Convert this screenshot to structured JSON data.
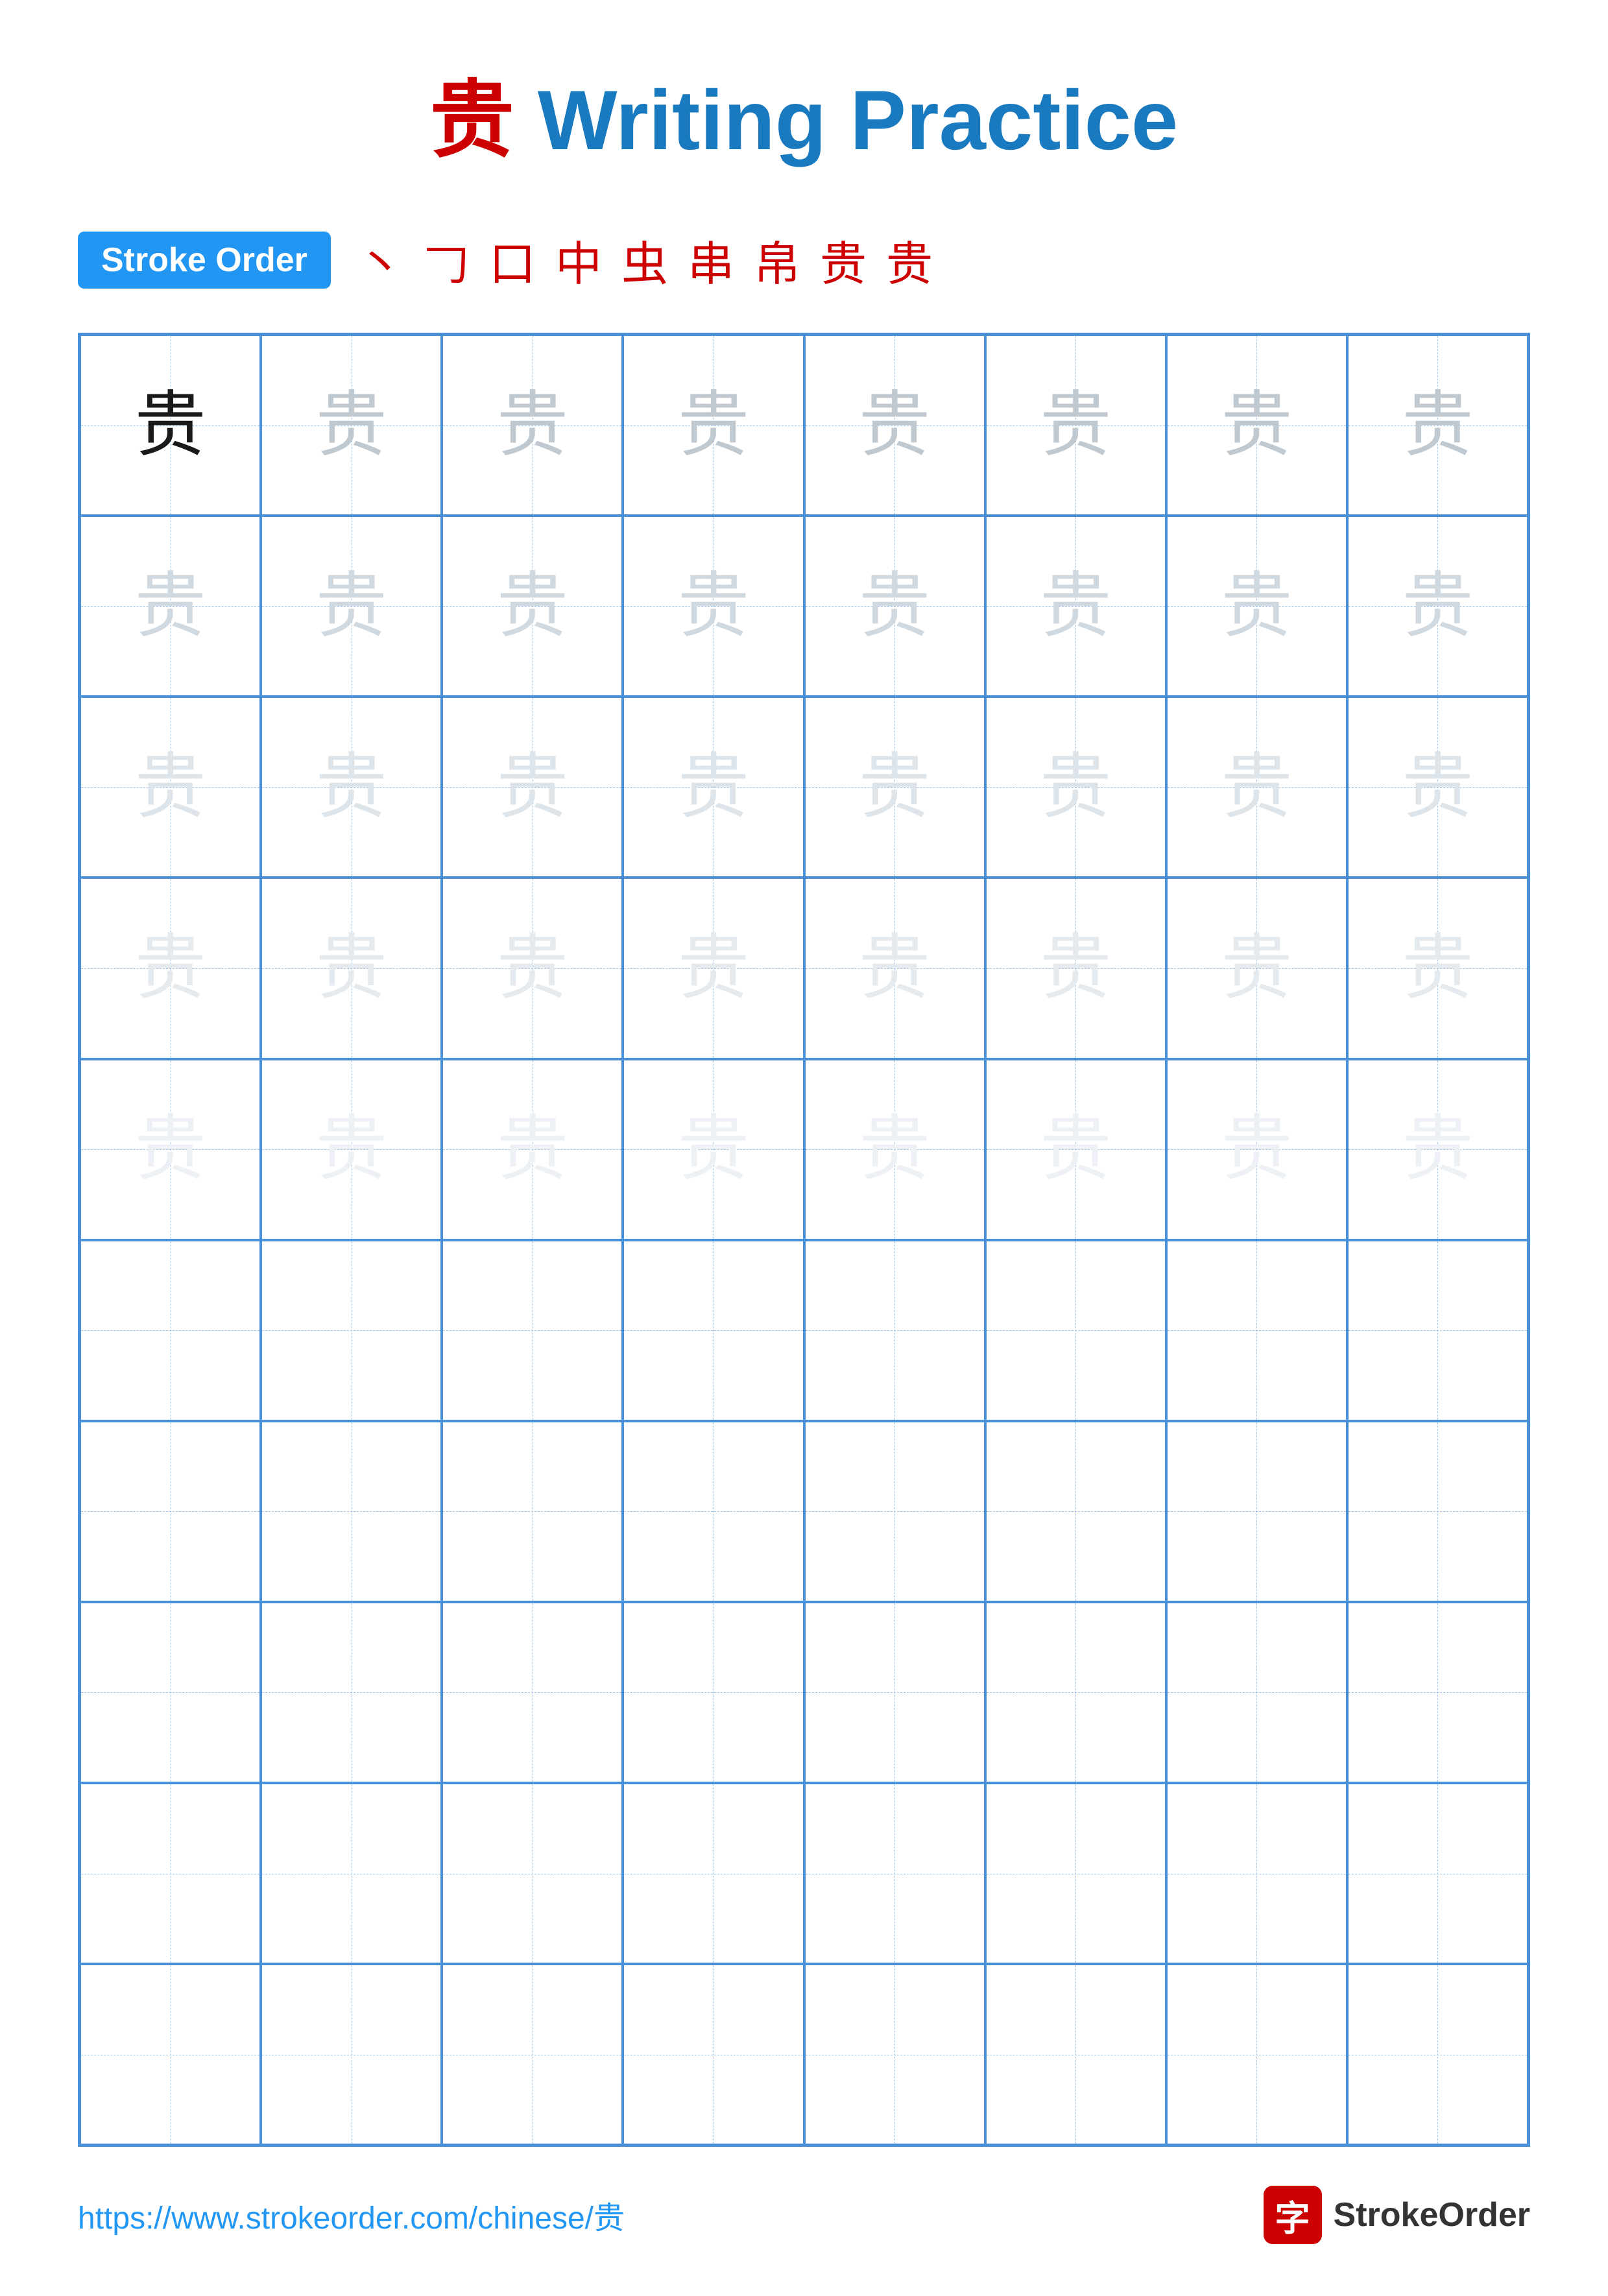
{
  "title": {
    "chinese": "贵",
    "english": " Writing Practice"
  },
  "stroke_order": {
    "badge_label": "Stroke Order",
    "steps": [
      "丶",
      "𠃌",
      "口",
      "中",
      "虫",
      "串",
      "帛",
      "贵",
      "贵"
    ]
  },
  "grid": {
    "cols": 8,
    "rows": 10,
    "character": "贵",
    "filled_rows": 5,
    "empty_rows": 5,
    "row_shades": [
      "dark",
      "light-1",
      "light-2",
      "light-3",
      "light-4"
    ]
  },
  "footer": {
    "url": "https://www.strokeorder.com/chinese/贵",
    "logo_char": "字",
    "logo_text": "StrokeOrder"
  }
}
